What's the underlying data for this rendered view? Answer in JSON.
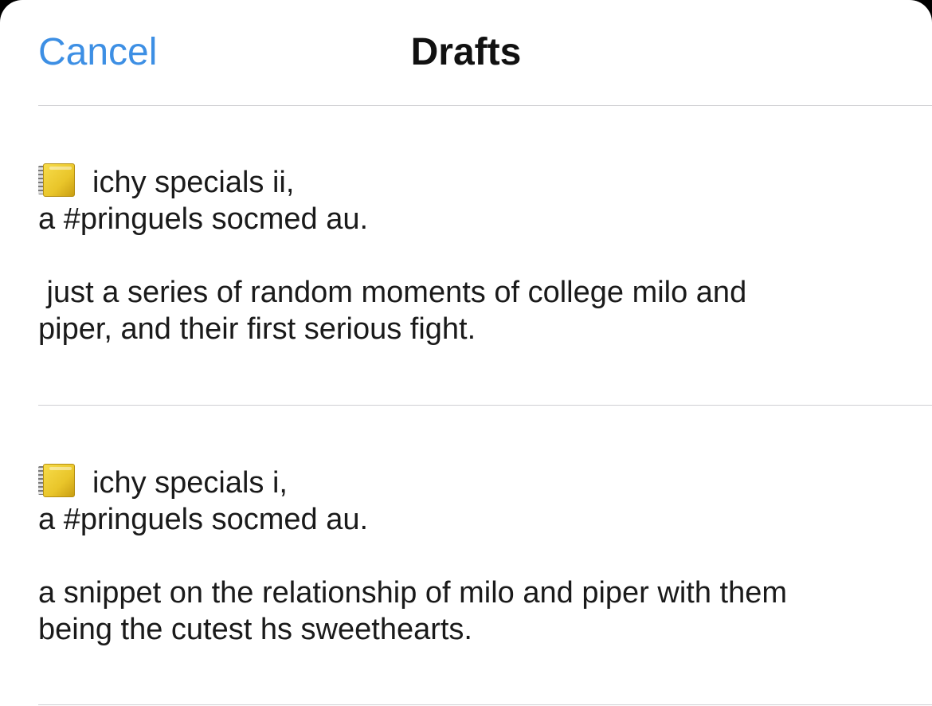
{
  "nav": {
    "cancel_label": "Cancel",
    "title": "Drafts"
  },
  "drafts": [
    {
      "icon": "notebook-icon",
      "line1": "ichy specials ii,",
      "line2": "a #pringuels socmed au.",
      "line3": " just a series of random moments of college milo and",
      "line4": "piper, and their first serious fight."
    },
    {
      "icon": "notebook-icon",
      "line1": "ichy specials i,",
      "line2": "a #pringuels socmed au.",
      "line3": "a snippet on the relationship of milo and piper with them",
      "line4": "being the cutest hs sweethearts."
    }
  ],
  "colors": {
    "accent": "#3d8fe4",
    "text": "#1a1a1a",
    "divider": "#cfcfd3",
    "background": "#ffffff"
  }
}
